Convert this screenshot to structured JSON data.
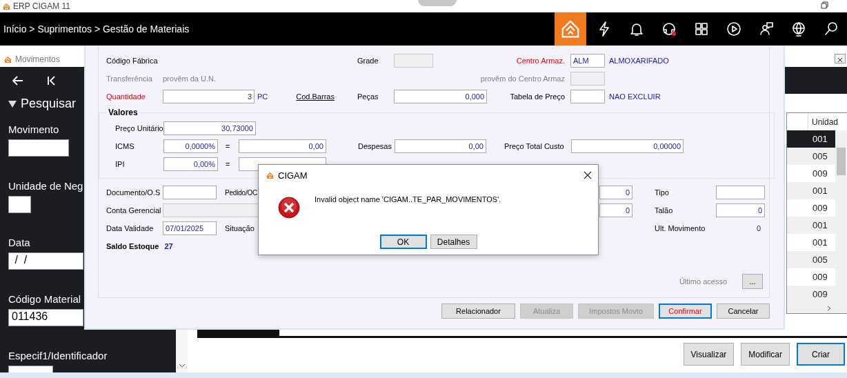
{
  "app": {
    "title": "ERP CIGAM 11"
  },
  "header": {
    "breadcrumb": "Início > Suprimentos > Gestão de Materiais"
  },
  "movimentos": {
    "title": "Movimentos",
    "search_title": "Pesquisar",
    "filters": [
      {
        "label": "Movimento"
      },
      {
        "label": "Unidade de Neg"
      },
      {
        "label": "Data",
        "value": " /  /"
      },
      {
        "label": "Código Material",
        "value": "011436"
      },
      {
        "label": "Especif1/Identificador"
      }
    ],
    "table": {
      "columns": [
        "Unidad"
      ],
      "rows": [
        {
          "unit": "001",
          "selected": true
        },
        {
          "unit": "005",
          "selected": false
        },
        {
          "unit": "009",
          "selected": false
        },
        {
          "unit": "001",
          "selected": false
        },
        {
          "unit": "009",
          "selected": false
        },
        {
          "unit": "001",
          "selected": false
        },
        {
          "unit": "001",
          "selected": false
        },
        {
          "unit": "005",
          "selected": false
        },
        {
          "unit": "009",
          "selected": false
        },
        {
          "unit": "009",
          "selected": false
        }
      ]
    },
    "buttons": [
      {
        "label": "Visualizar",
        "focused": false
      },
      {
        "label": "Modificar",
        "focused": false
      },
      {
        "label": "Criar",
        "focused": true
      }
    ]
  },
  "form": {
    "codigo_fabrica": {
      "label": "Código Fábrica"
    },
    "grade": {
      "label": "Grade",
      "disabled": true
    },
    "centro_armaz": {
      "label": "Centro Armaz.",
      "required": true,
      "value": "ALM",
      "description": "ALMOXARIFADO"
    },
    "transferencia": {
      "label": "Transferência",
      "note": "provêm da U.N."
    },
    "centro_origem": {
      "label": "provêm do Centro Armaz",
      "disabled": true
    },
    "quantidade": {
      "label": "Quantidade",
      "required": true,
      "value": "3",
      "unit": "PC"
    },
    "cod_barras": {
      "label": "Cod.Barras"
    },
    "pecas": {
      "label": "Peças",
      "value": "0,000"
    },
    "tabela_preco": {
      "label": "Tabela de Preço",
      "description": "NAO EXCLUIR"
    },
    "valores": {
      "title": "Valores",
      "preco_unitario": {
        "label": "Preço Unitário",
        "value": "30,73000"
      },
      "icms": {
        "label": "ICMS",
        "rate": "0,0000%",
        "equals": "=",
        "amount": "0,00"
      },
      "ipi": {
        "label": "IPI",
        "rate": "0,00%",
        "equals": "="
      },
      "despesas": {
        "label": "Despesas",
        "value": "0,00"
      },
      "preco_total_custo": {
        "label": "Preço Total Custo",
        "value": "0,00000"
      }
    },
    "documento": {
      "label": "Documento/O.S"
    },
    "pedido": {
      "label": "Pedido/OC"
    },
    "column_3_values": [
      "0",
      "0"
    ],
    "tipo": {
      "label": "Tipo"
    },
    "conta_gerencial": {
      "label": "Conta Gerencial",
      "disabled": true
    },
    "talao": {
      "label": "Talão",
      "value": "0"
    },
    "data_validade": {
      "label": "Data Validade",
      "value": "07/01/2025"
    },
    "situacao": {
      "label": "Situação"
    },
    "ult_movimento": {
      "label": "Ult. Movimento",
      "value": "0"
    },
    "saldo_estoque": {
      "label": "Saldo Estoque",
      "value": "27"
    },
    "ultimo_acesso": {
      "label": "Último acesso",
      "button": "..."
    },
    "buttons": [
      {
        "label": "Relacionador",
        "disabled": false,
        "focused": false
      },
      {
        "label": "Atualiza",
        "disabled": true,
        "focused": false
      },
      {
        "label": "Impostos Movto",
        "disabled": true,
        "focused": false
      },
      {
        "label": "Confirmar",
        "disabled": false,
        "focused": true
      },
      {
        "label": "Cancelar",
        "disabled": false,
        "focused": false
      }
    ]
  },
  "dialog": {
    "title": "CIGAM",
    "message": "Invalid object name 'CIGAM..TE_PAR_MOVIMENTOS'.",
    "buttons": [
      {
        "label": "OK",
        "focused": true
      },
      {
        "label": "Detalhes",
        "focused": false
      }
    ]
  }
}
